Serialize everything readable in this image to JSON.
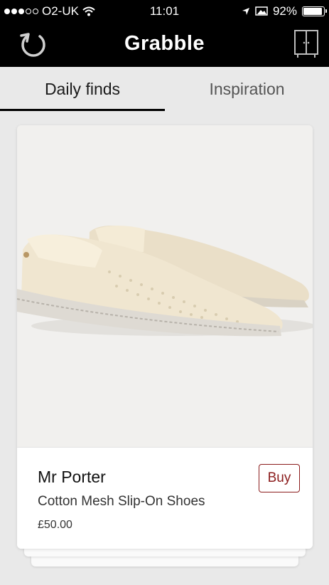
{
  "status_bar": {
    "carrier": "O2-UK",
    "time": "11:01",
    "battery": "92%",
    "battery_level": 0.92,
    "signal_bars": 3,
    "signal_total": 5
  },
  "navbar": {
    "logo": "Grabble",
    "left_icon": "refresh-icon",
    "right_icon": "wardrobe-icon"
  },
  "tabs": [
    {
      "label": "Daily finds",
      "active": true
    },
    {
      "label": "Inspiration",
      "active": false
    }
  ],
  "card": {
    "brand": "Mr Porter",
    "product_name": "Cotton Mesh Slip-On Shoes",
    "price": "£50.00",
    "buy_label": "Buy"
  },
  "colors": {
    "bar_background": "#000000",
    "accent": "#8b1c1c",
    "page_background": "#e9e9e9"
  }
}
